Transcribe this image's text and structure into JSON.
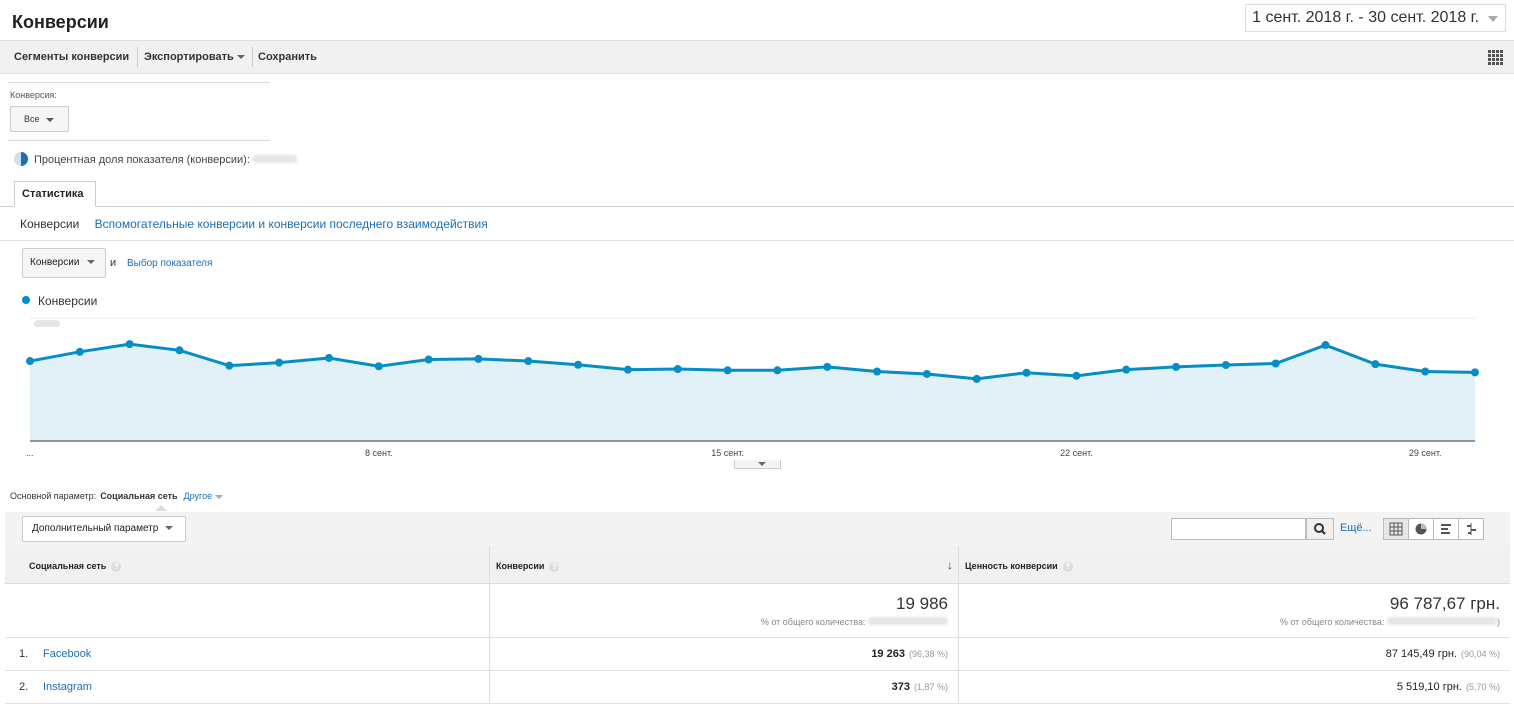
{
  "header": {
    "title": "Конверсии",
    "date_range": "1 сент. 2018 г. - 30 сент. 2018 г."
  },
  "toolbar": {
    "segments": "Сегменты конверсии",
    "export": "Экспортировать",
    "save": "Сохранить"
  },
  "conversion_filter": {
    "label": "Конверсия:",
    "value": "Все"
  },
  "percent_share": "Процентная доля показателя (конверсии):",
  "tabs": {
    "stat": "Статистика"
  },
  "subtabs": {
    "conversions": "Конверсии",
    "assisted": "Вспомогательные конверсии и конверсии последнего взаимодействия"
  },
  "metric": {
    "selected": "Конверсии",
    "and": "и",
    "choose": "Выбор показателя"
  },
  "chart_data": {
    "type": "area",
    "series": [
      {
        "name": "Конверсии",
        "values": [
          760,
          790,
          815,
          795,
          745,
          755,
          770,
          743,
          765,
          767,
          760,
          748,
          732,
          734,
          730,
          730,
          741,
          726,
          718,
          702,
          722,
          712,
          732,
          741,
          747,
          752,
          812,
          750,
          726,
          723
        ]
      }
    ],
    "x": [
      "1 сент.",
      "2 сент.",
      "3 сент.",
      "4 сент.",
      "5 сент.",
      "6 сент.",
      "7 сент.",
      "8 сент.",
      "9 сент.",
      "10 сент.",
      "11 сент.",
      "12 сент.",
      "13 сент.",
      "14 сент.",
      "15 сент.",
      "16 сент.",
      "17 сент.",
      "18 сент.",
      "19 сент.",
      "20 сент.",
      "21 сент.",
      "22 сент.",
      "23 сент.",
      "24 сент.",
      "25 сент.",
      "26 сент.",
      "27 сент.",
      "28 сент.",
      "29 сент.",
      "30 сент."
    ],
    "x_tick_labels": [
      "...",
      "8 сент.",
      "15 сент.",
      "22 сент.",
      "29 сент."
    ],
    "ylim": [
      500,
      900
    ],
    "grid": true,
    "legend": "top-left",
    "color": "#058dc7",
    "fill_color": "#e2f0f8"
  },
  "dimension": {
    "label": "Основной параметр:",
    "selected": "Социальная сеть",
    "other": "Другое"
  },
  "secondary_dimension": "Дополнительный параметр",
  "search": {
    "placeholder": ""
  },
  "more": "Ещё...",
  "table": {
    "headers": [
      "Социальная сеть",
      "Конверсии",
      "Ценность конверсии"
    ],
    "totals": {
      "conversions": "19 986",
      "conversions_sub": "% от общего количества:",
      "value": "96 787,67 грн.",
      "value_sub": "% от общего количества:"
    },
    "rows": [
      {
        "num": "1.",
        "name": "Facebook",
        "conv": "19 263",
        "conv_pct": "(96,38 %)",
        "value": "87 145,49 грн.",
        "value_pct": "(90,04 %)"
      },
      {
        "num": "2.",
        "name": "Instagram",
        "conv": "373",
        "conv_pct": "(1,87 %)",
        "value": "5 519,10 грн.",
        "value_pct": "(5,70 %)"
      }
    ]
  }
}
